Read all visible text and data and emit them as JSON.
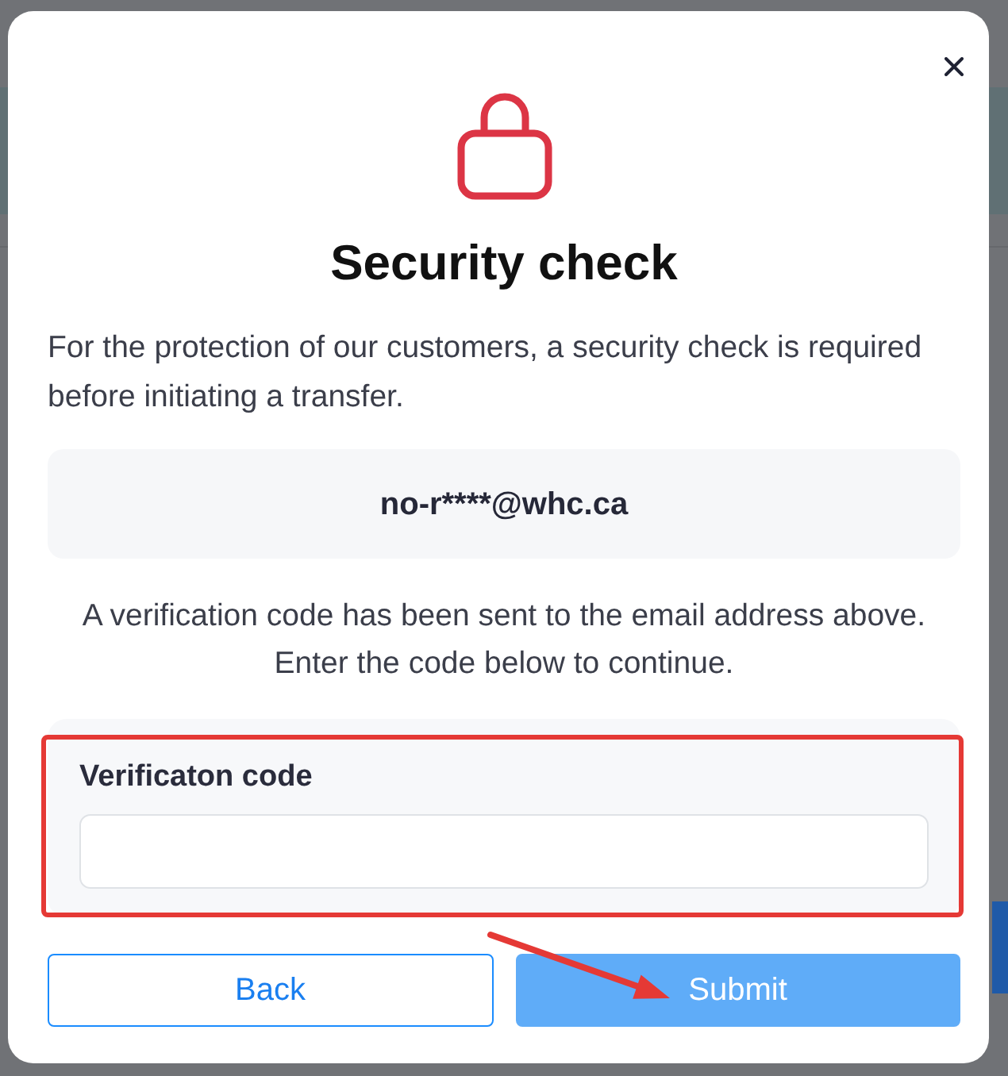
{
  "dialog": {
    "title": "Security check",
    "intro": "For the protection of our customers, a security check is required before initiating a transfer.",
    "email": "no-r****@whc.ca",
    "instructions": "A verification code has been sent to the email address above. Enter the code below to continue.",
    "field": {
      "label": "Verificaton code"
    },
    "buttons": [
      {
        "label": "Back",
        "kind": "secondary",
        "disabled": false
      },
      {
        "label": "Submit",
        "kind": "primary",
        "disabled": true
      }
    ]
  }
}
